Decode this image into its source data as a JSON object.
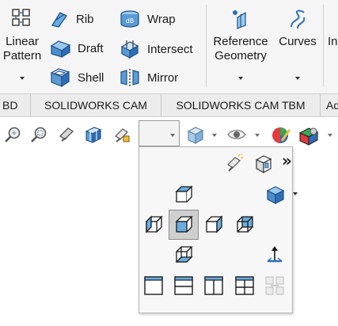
{
  "ribbon": {
    "linear_pattern": {
      "line1": "Linear",
      "line2": "Pattern"
    },
    "rib": "Rib",
    "draft": "Draft",
    "shell": "Shell",
    "wrap": "Wrap",
    "intersect": "Intersect",
    "mirror": "Mirror",
    "reference_geometry": {
      "line1": "Reference",
      "line2": "Geometry"
    },
    "curves": "Curves",
    "cutoff_next": "In"
  },
  "tabs": {
    "items": [
      "BD",
      "SOLIDWORKS CAM",
      "SOLIDWORKS CAM TBM",
      "Ad"
    ]
  },
  "heads_up_toolbar": {
    "icons": [
      "zoom-to-fit-icon",
      "zoom-to-area-icon",
      "previous-view-icon",
      "section-view-icon",
      "dynamic-annotation-icon",
      "view-orientation-icon",
      "display-style-icon",
      "hide-show-items-icon",
      "edit-appearance-icon",
      "apply-scene-icon"
    ]
  },
  "orientation_flyout": {
    "more_glyph": "»",
    "standard_views": [
      "top",
      "left",
      "front",
      "right",
      "back",
      "bottom"
    ],
    "viewport_layouts": [
      "single-view",
      "two-view-horizontal",
      "two-view-vertical",
      "four-view"
    ],
    "selected_view": "front"
  },
  "colors": {
    "accent_blue": "#2f6fb8",
    "cube_fill": "#6aaee0",
    "selected_bg": "#cfcfcf"
  }
}
